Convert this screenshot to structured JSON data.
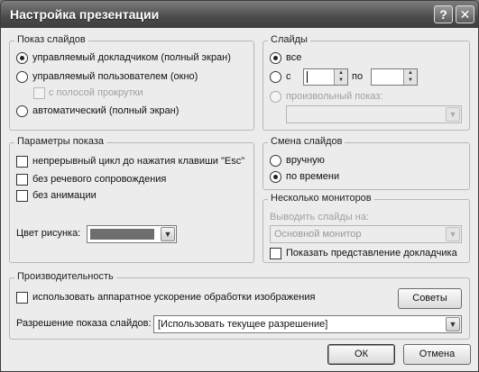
{
  "window": {
    "title": "Настройка презентации",
    "help_label": "?",
    "close_label": "✕"
  },
  "show_type": {
    "label": "Показ слайдов",
    "options": [
      {
        "label": "управляемый докладчиком (полный экран)",
        "selected": true
      },
      {
        "label": "управляемый пользователем (окно)",
        "selected": false
      },
      {
        "label": "автоматический (полный экран)",
        "selected": false
      }
    ],
    "scrollbar_label": "с полосой прокрутки"
  },
  "slides": {
    "label": "Слайды",
    "all_label": "все",
    "from_label": "с",
    "to_label": "по",
    "custom_label": "произвольный показ:",
    "from_value": "",
    "to_value": ""
  },
  "show_options": {
    "label": "Параметры показа",
    "loop_label": "непрерывный цикл до нажатия клавиши \"Esc\"",
    "no_narration_label": "без речевого сопровождения",
    "no_animation_label": "без анимации",
    "pen_color_label": "Цвет рисунка:",
    "pen_color": "#6e6e6e"
  },
  "advance": {
    "label": "Смена слайдов",
    "manual_label": "вручную",
    "timings_label": "по времени"
  },
  "monitors": {
    "label": "Несколько мониторов",
    "display_on_label": "Выводить слайды на:",
    "monitor_value": "Основной монитор",
    "presenter_view_label": "Показать представление докладчика"
  },
  "performance": {
    "label": "Производительность",
    "hw_accel_label": "использовать аппаратное ускорение обработки изображения",
    "tips_label": "Советы",
    "resolution_label": "Разрешение показа слайдов:",
    "resolution_value": "[Использовать текущее разрешение]"
  },
  "footer": {
    "ok_label": "ОК",
    "cancel_label": "Отмена"
  }
}
